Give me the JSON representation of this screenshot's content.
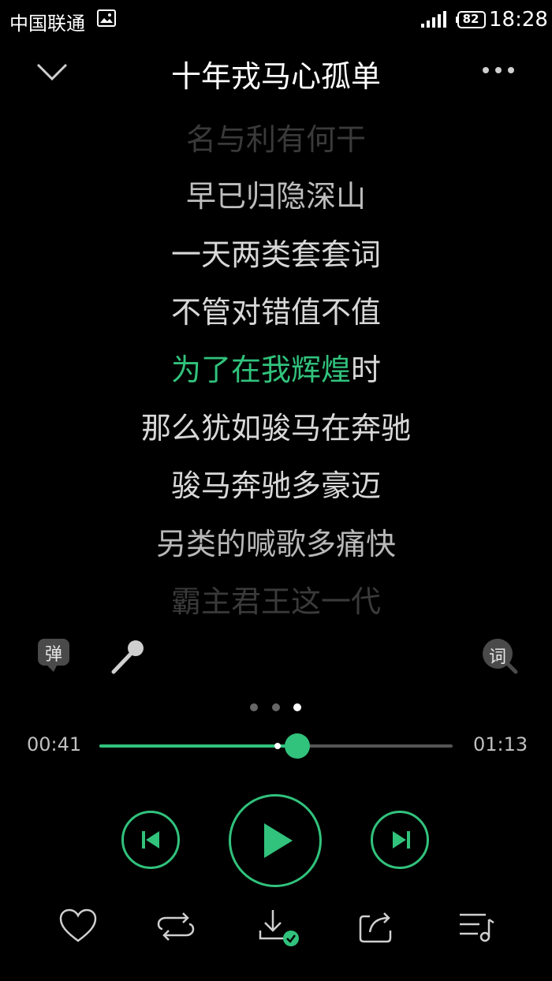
{
  "status_bar": {
    "carrier": "中国联通",
    "battery": "82",
    "time": "18:28"
  },
  "header": {
    "title": "十年戎马心孤单"
  },
  "lyrics": [
    {
      "text": "名与利有何干",
      "style": "faded"
    },
    {
      "text": "早已归隐深山",
      "style": "normal"
    },
    {
      "text": "一天两类套套词",
      "style": "normal"
    },
    {
      "text": "不管对错值不值",
      "style": "normal"
    },
    {
      "highlight": "为了在我辉煌",
      "rest": "时",
      "style": "current"
    },
    {
      "text": "那么犹如骏马在奔驰",
      "style": "normal"
    },
    {
      "text": "骏马奔驰多豪迈",
      "style": "normal"
    },
    {
      "text": "另类的喊歌多痛快",
      "style": "normal"
    },
    {
      "text": "霸主君王这一代",
      "style": "faded"
    }
  ],
  "tools": {
    "danmaku_label": "弹",
    "lyric_search_label": "词"
  },
  "pager": {
    "pages": 3,
    "active": 3
  },
  "progress": {
    "elapsed": "00:41",
    "total": "01:13",
    "played_fraction": 0.56,
    "buffered_fraction": 0.505
  },
  "icons": {
    "collapse": "chevron-down-icon",
    "more": "more-icon",
    "danmaku": "danmaku-icon",
    "mic": "microphone-icon",
    "lyric_search": "lyric-search-icon",
    "prev": "previous-icon",
    "play": "play-icon",
    "next": "next-icon",
    "like": "heart-icon",
    "loop": "repeat-icon",
    "download": "download-done-icon",
    "share": "share-icon",
    "playlist": "playlist-icon"
  },
  "colors": {
    "accent": "#31c27c",
    "background": "#000000",
    "text": "#d8d8d8"
  }
}
